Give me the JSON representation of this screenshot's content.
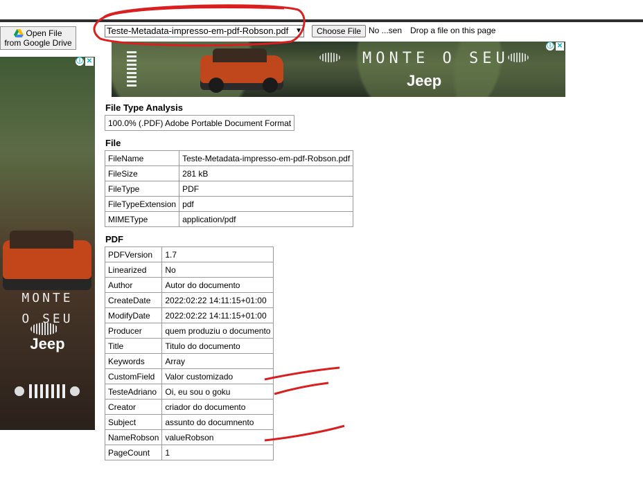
{
  "google_drive": {
    "label_line1": "Open File",
    "label_line2": "from Google Drive"
  },
  "file_picker": {
    "selected_file": "Teste-Metadata-impresso-em-pdf-Robson.pdf",
    "choose_button": "Choose File",
    "no_file_text": "No ...sen",
    "drop_hint": "Drop a file on this page"
  },
  "ads": {
    "top": {
      "headline": "MONTE O SEU",
      "brand": "Jeep"
    },
    "side": {
      "line1": "MONTE",
      "line2": "O SEU",
      "brand": "Jeep"
    },
    "info_icon": "ⓘ",
    "close_icon": "✕"
  },
  "sections": {
    "file_type_analysis": {
      "title": "File Type Analysis",
      "result": "100.0% (.PDF) Adobe Portable Document Format"
    },
    "file": {
      "title": "File",
      "rows": [
        {
          "key": "FileName",
          "value": "Teste-Metadata-impresso-em-pdf-Robson.pdf"
        },
        {
          "key": "FileSize",
          "value": "281 kB"
        },
        {
          "key": "FileType",
          "value": "PDF"
        },
        {
          "key": "FileTypeExtension",
          "value": "pdf"
        },
        {
          "key": "MIMEType",
          "value": "application/pdf"
        }
      ]
    },
    "pdf": {
      "title": "PDF",
      "rows": [
        {
          "key": "PDFVersion",
          "value": "1.7"
        },
        {
          "key": "Linearized",
          "value": "No"
        },
        {
          "key": "Author",
          "value": "Autor do documento"
        },
        {
          "key": "CreateDate",
          "value": "2022:02:22 14:11:15+01:00"
        },
        {
          "key": "ModifyDate",
          "value": "2022:02:22 14:11:15+01:00"
        },
        {
          "key": "Producer",
          "value": "quem produziu o documento"
        },
        {
          "key": "Title",
          "value": "Titulo do documento"
        },
        {
          "key": "Keywords",
          "value": "Array"
        },
        {
          "key": "CustomField",
          "value": "Valor customizado"
        },
        {
          "key": "TesteAdriano",
          "value": "Oi, eu sou o goku"
        },
        {
          "key": "Creator",
          "value": "criador do documento"
        },
        {
          "key": "Subject",
          "value": "assunto do documnento"
        },
        {
          "key": "NameRobson",
          "value": "valueRobson"
        },
        {
          "key": "PageCount",
          "value": "1"
        }
      ]
    }
  },
  "annotation_color": "#d91f1f"
}
